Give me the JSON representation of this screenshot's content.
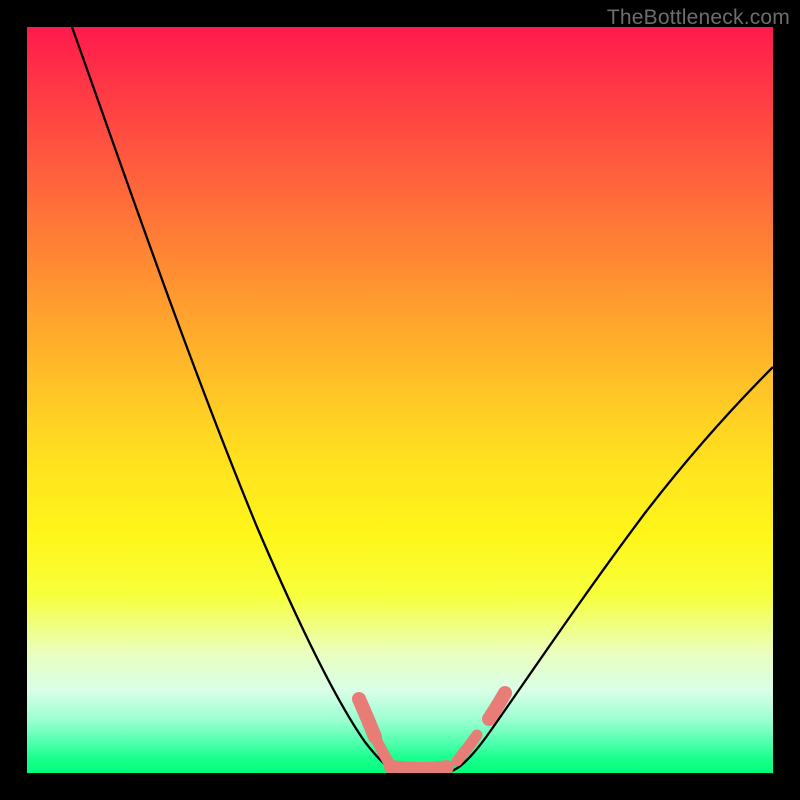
{
  "watermark": "TheBottleneck.com",
  "colors": {
    "frame": "#000000",
    "watermark_text": "#6d6d6d",
    "curve": "#000000",
    "annotation": "#e77d76"
  },
  "chart_data": {
    "type": "line",
    "title": "",
    "xlabel": "",
    "ylabel": "",
    "xlim": [
      0,
      100
    ],
    "ylim": [
      0,
      100
    ],
    "background_gradient": {
      "direction": "top_to_bottom",
      "stops": [
        {
          "pct": 0,
          "color": "#ff1a4d"
        },
        {
          "pct": 50,
          "color": "#ffd324"
        },
        {
          "pct": 90,
          "color": "#e6ffd0"
        },
        {
          "pct": 100,
          "color": "#00ff7a"
        }
      ]
    },
    "series": [
      {
        "name": "left-branch",
        "x": [
          6.0,
          12.0,
          18.0,
          24.0,
          30.0,
          36.0,
          40.5,
          44.0,
          47.0,
          49.0
        ],
        "y": [
          100.0,
          83.0,
          67.0,
          51.0,
          36.0,
          22.0,
          12.5,
          6.0,
          2.0,
          0.0
        ]
      },
      {
        "name": "right-branch",
        "x": [
          57.0,
          59.5,
          63.0,
          68.0,
          74.0,
          82.0,
          91.0,
          100.0
        ],
        "y": [
          0.0,
          2.0,
          6.0,
          13.0,
          22.0,
          33.0,
          44.0,
          55.0
        ]
      },
      {
        "name": "valley-floor",
        "x": [
          49.0,
          51.0,
          53.0,
          55.0,
          57.0
        ],
        "y": [
          0.0,
          0.0,
          0.0,
          0.0,
          0.0
        ]
      }
    ],
    "annotations": [
      {
        "name": "scribble-left-descent",
        "approx_xy": [
          [
            44.5,
            9.5
          ],
          [
            47.0,
            3.5
          ]
        ],
        "style": "rough-stroke"
      },
      {
        "name": "scribble-valley-floor",
        "approx_xy": [
          [
            48.5,
            0.5
          ],
          [
            56.0,
            0.5
          ]
        ],
        "style": "rough-stroke"
      },
      {
        "name": "scribble-right-ascent-lower",
        "approx_xy": [
          [
            58.0,
            1.5
          ],
          [
            60.5,
            4.5
          ]
        ],
        "style": "rough-stroke"
      },
      {
        "name": "scribble-right-ascent-upper",
        "approx_xy": [
          [
            62.0,
            7.0
          ],
          [
            63.5,
            9.5
          ]
        ],
        "style": "rough-stroke"
      }
    ]
  }
}
